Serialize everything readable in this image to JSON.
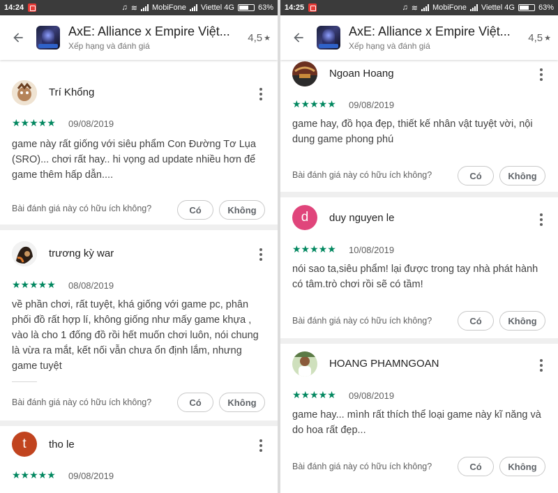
{
  "left": {
    "status": {
      "time": "14:24",
      "carrier1": "MobiFone",
      "carrier2": "Viettel 4G",
      "battery": "63%",
      "battery_level": 0.63
    },
    "appbar": {
      "title": "AxE: Alliance x Empire Việt...",
      "subtitle": "Xếp hạng và đánh giá",
      "rating": "4,5",
      "rating_star": "★"
    },
    "reviews": [
      {
        "name": "Trí Khổng",
        "avatar_letter": "",
        "avatar_color": "#b5835a",
        "stars": "★★★★★",
        "date": "09/08/2019",
        "text": "game này rất giống với siêu phẩm Con Đường Tơ Lụa (SRO)... chơi rất hay.. hi vọng ad update nhiều hơn để game thêm hấp dẫn....",
        "helpful": "Bài đánh giá này có hữu ích không?",
        "yes": "Có",
        "no": "Không"
      },
      {
        "name": "trương kỳ war",
        "avatar_letter": "",
        "avatar_color": "#3a2a1f",
        "stars": "★★★★★",
        "date": "08/08/2019",
        "text": "về phần chơi, rất tuyệt, khá giống với game pc, phân phối đồ rất hợp lí, không giống như mấy game khựa , vào là cho 1 đống đồ rồi hết muốn chơi luôn, nói chung là vừa ra mắt, kết nối vẫn chưa ổn định lắm, nhưng game tuyệt",
        "helpful": "Bài đánh giá này có hữu ích không?",
        "yes": "Có",
        "no": "Không"
      },
      {
        "name": "tho le",
        "avatar_letter": "t",
        "avatar_color": "#c1441f",
        "stars": "★★★★★",
        "date": "09/08/2019"
      }
    ]
  },
  "right": {
    "status": {
      "time": "14:25",
      "carrier1": "MobiFone",
      "carrier2": "Viettel 4G",
      "battery": "63%",
      "battery_level": 0.63
    },
    "appbar": {
      "title": "AxE: Alliance x Empire Việt...",
      "subtitle": "Xếp hạng và đánh giá",
      "rating": "4,5",
      "rating_star": "★"
    },
    "reviews": [
      {
        "name": "Ngoan Hoang",
        "avatar_letter": "",
        "avatar_color": "#7a3b2a",
        "stars": "★★★★★",
        "date": "09/08/2019",
        "text": "game hay, đồ họa đẹp, thiết kế nhân vật tuyệt vời, nội dung game phong phú",
        "helpful": "Bài đánh giá này có hữu ích không?",
        "yes": "Có",
        "no": "Không"
      },
      {
        "name": "duy nguyen le",
        "avatar_letter": "d",
        "avatar_color": "#e0457b",
        "stars": "★★★★★",
        "date": "10/08/2019",
        "text": "nói sao ta,siêu phẩm! lại được trong tay nhà phát hành có tâm.trò chơi rồi sẽ có tầm!",
        "helpful": "Bài đánh giá này có hữu ích không?",
        "yes": "Có",
        "no": "Không"
      },
      {
        "name": "HOANG PHAMNGOAN",
        "avatar_letter": "",
        "avatar_color": "#5b7a46",
        "stars": "★★★★★",
        "date": "09/08/2019",
        "text": "game hay... mình rất thích thể loại game này kĩ năng và do hoa rất đẹp...",
        "helpful": "Bài đánh giá này có hữu ích không?",
        "yes": "Có",
        "no": "Không"
      }
    ]
  },
  "colors": {
    "star_green": "#01875f",
    "status_bar": "#3b3b3b"
  },
  "icons": {
    "back": "arrow-left-icon",
    "more": "more-vert-icon"
  }
}
